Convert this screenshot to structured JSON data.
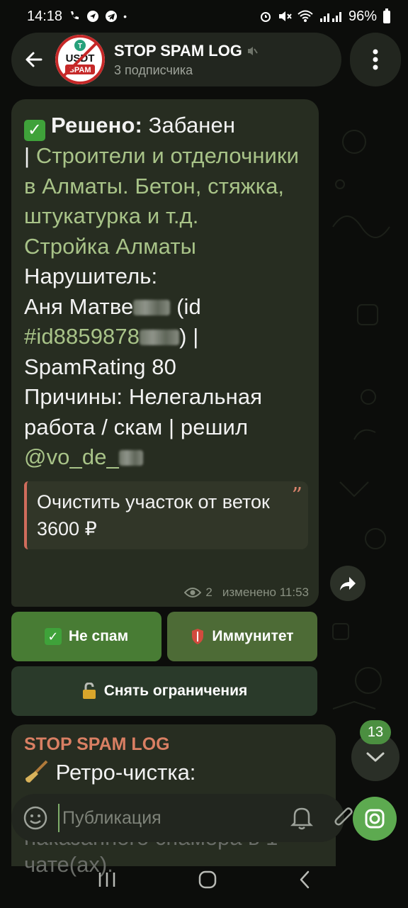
{
  "status": {
    "time": "14:18",
    "battery": "96%"
  },
  "header": {
    "back_icon": "arrow-left-icon",
    "channel_title": "STOP SPAM LOG",
    "subtitle": "3 подписчика",
    "muted_icon": "muted-speaker-icon",
    "menu_icon": "more-vertical-icon",
    "avatar": {
      "top_text": "USDT",
      "bottom_text": "SPAM",
      "accent": "#c62828",
      "coin_color": "#26a17b"
    }
  },
  "message": {
    "resolved_label": "Решено:",
    "resolved_value": "Забанен",
    "separator": "|",
    "chat_link": "Строители и отделочники в Алматы. Бетон, стяжка, штукатурка и т.д.",
    "chat_link2": "Стройка Алматы",
    "violator_label": "Нарушитель:",
    "violator_name": "Аня Матве",
    "id_open": "(id",
    "id_link": "#id8859878",
    "id_close": ") |",
    "spam_rating": "SpamRating 80",
    "reasons": "Причины: Нелегальная работа / скам | решил",
    "resolver": "@vo_de_",
    "quote_text": "Очистить участок от веток 3600 ₽",
    "views": "2",
    "edited": "изменено 11:53"
  },
  "buttons": {
    "not_spam": "Не спам",
    "immunity": "Иммунитет",
    "remove_restrictions": "Снять ограничения"
  },
  "message2": {
    "sender": "STOP SPAM LOG",
    "text": "Ретро-чистка:",
    "hidden_text": "наказанного спамера в 1 чате(ах)."
  },
  "scroll": {
    "unread": "13"
  },
  "composer": {
    "placeholder": "Публикация"
  },
  "colors": {
    "bubble": "#272d21",
    "link": "#a8c388",
    "accent_green": "#5daa50",
    "quote_bar": "#d06c5c"
  }
}
